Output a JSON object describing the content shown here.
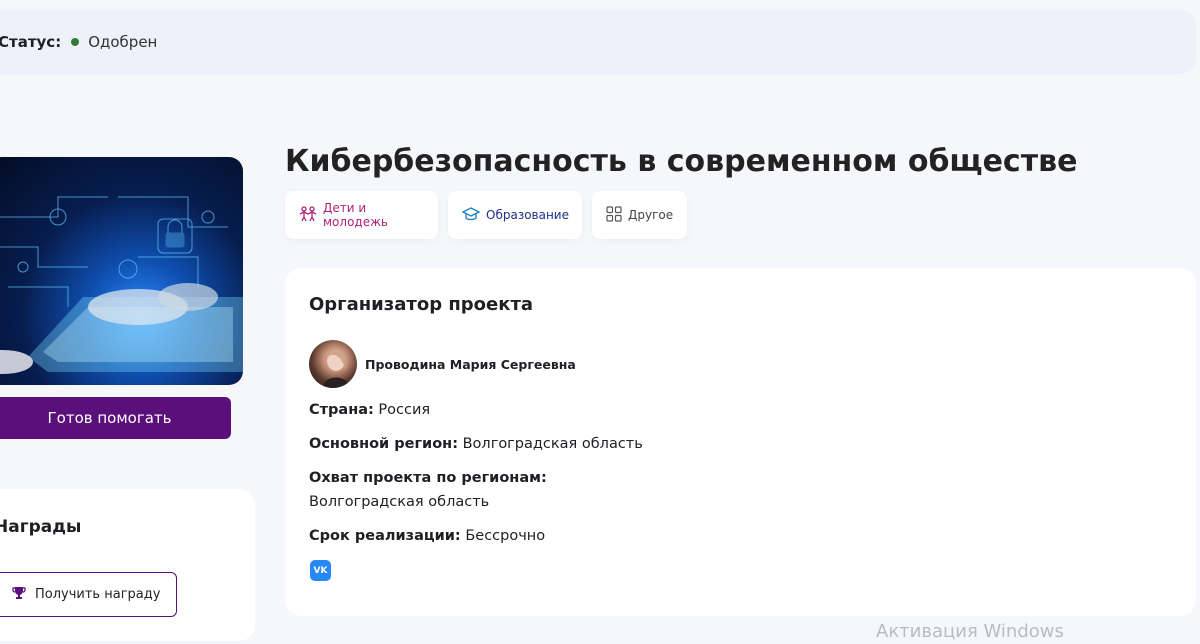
{
  "status": {
    "label": "Статус:",
    "value": "Одобрен",
    "dot_color": "#2e7d32"
  },
  "project": {
    "title": "Кибербезопасность в современном обществе",
    "image_icon": "cybersecurity-image"
  },
  "tags": [
    {
      "label": "Дети и молодежь",
      "icon": "children-icon",
      "color": "#b0237a"
    },
    {
      "label": "Образование",
      "icon": "graduation-cap-icon",
      "color": "#20308a"
    },
    {
      "label": "Другое",
      "icon": "grid-icon",
      "color": "#444444"
    }
  ],
  "actions": {
    "help_label": "Готов помогать"
  },
  "awards": {
    "title": "Награды",
    "button_label": "Получить награду"
  },
  "organizer": {
    "title": "Организатор проекта",
    "name": "Проводина Мария Сергеевна",
    "country_label": "Страна:",
    "country_value": "Россия",
    "region_label": "Основной регион:",
    "region_value": "Волгоградская область",
    "reach_label": "Охват проекта по регионам:",
    "reach_value": "Волгоградская область",
    "term_label": "Срок реализации:",
    "term_value": "Бессрочно",
    "social_icon": "vk-icon",
    "social_text": "VK"
  },
  "system": {
    "watermark": "Активация Windows"
  },
  "colors": {
    "accent": "#5a0f7a",
    "background": "#f6f7fb",
    "vk": "#2787f5"
  }
}
